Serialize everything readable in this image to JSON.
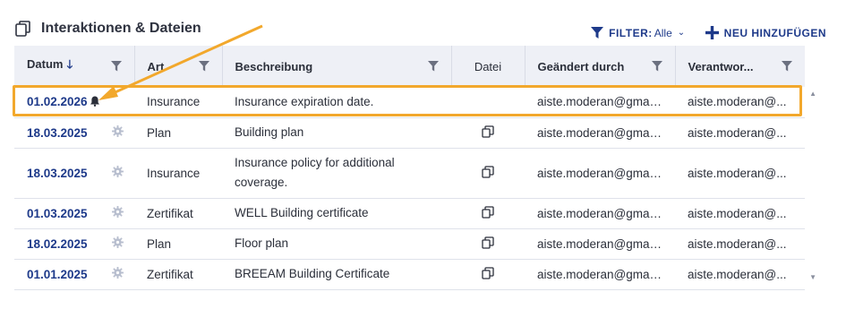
{
  "header": {
    "title": "Interaktionen & Dateien",
    "filter_label": "FILTER:",
    "filter_value": "Alle",
    "add_label": "NEU HINZUFÜGEN"
  },
  "columns": {
    "datum": "Datum",
    "art": "Art",
    "beschreibung": "Beschreibung",
    "datei": "Datei",
    "geaendert": "Geändert durch",
    "verantwortlich": "Verantwor..."
  },
  "rows": [
    {
      "date": "01.02.2026",
      "type": "Insurance",
      "desc": "Insurance expiration date.",
      "changed_by": "aiste.moderan@gmail....",
      "responsible": "aiste.moderan@...",
      "has_file": false,
      "has_bell": true
    },
    {
      "date": "18.03.2025",
      "type": "Plan",
      "desc": "Building plan",
      "changed_by": "aiste.moderan@gmail....",
      "responsible": "aiste.moderan@...",
      "has_file": true,
      "has_bell": false
    },
    {
      "date": "18.03.2025",
      "type": "Insurance",
      "desc": "Insurance policy for additional coverage.",
      "changed_by": "aiste.moderan@gmail....",
      "responsible": "aiste.moderan@...",
      "has_file": true,
      "has_bell": false
    },
    {
      "date": "01.03.2025",
      "type": "Zertifikat",
      "desc": "WELL Building certificate",
      "changed_by": "aiste.moderan@gmail....",
      "responsible": "aiste.moderan@...",
      "has_file": true,
      "has_bell": false
    },
    {
      "date": "18.02.2025",
      "type": "Plan",
      "desc": "Floor plan",
      "changed_by": "aiste.moderan@gmail....",
      "responsible": "aiste.moderan@...",
      "has_file": true,
      "has_bell": false
    },
    {
      "date": "01.01.2025",
      "type": "Zertifikat",
      "desc": "BREEAM Building Certificate",
      "changed_by": "aiste.moderan@gmail....",
      "responsible": "aiste.moderan@...",
      "has_file": true,
      "has_bell": false
    }
  ],
  "colors": {
    "accent": "#1e3a8a",
    "highlight": "#f2a82c"
  }
}
